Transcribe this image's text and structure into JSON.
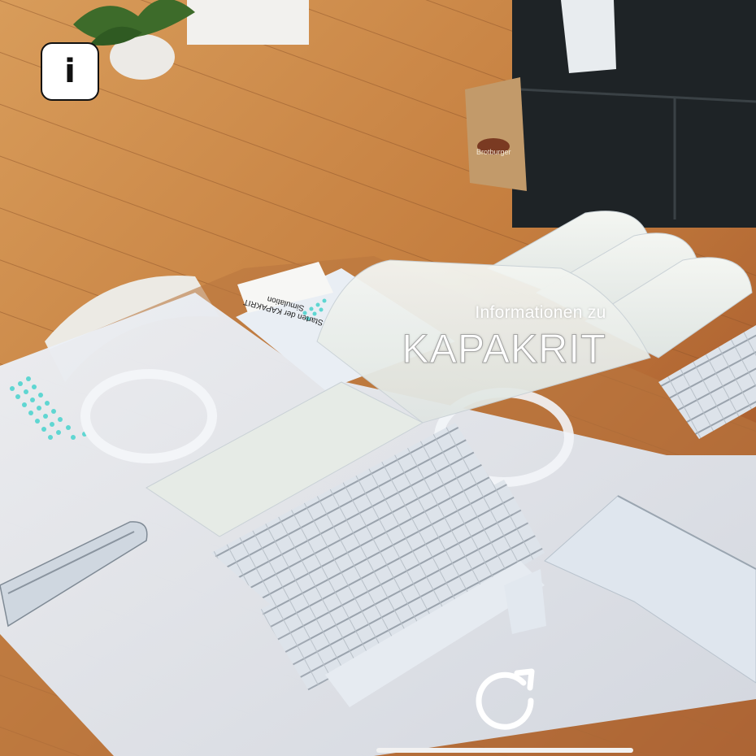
{
  "overlay": {
    "subtitle": "Informationen zu",
    "title": "KAPAKRIT"
  },
  "buttons": {
    "info_label": "i",
    "info_icon": "info-icon",
    "reload_icon": "reload-icon"
  },
  "flyer": {
    "text": "Starten der KAPAKRIT Simulation"
  },
  "bag_text": "Brotburger",
  "colors": {
    "floor": "#c98a4b",
    "model": "#e8edf4",
    "accent_dots": "#5fd6d2",
    "overlay_text": "#ffffff"
  }
}
